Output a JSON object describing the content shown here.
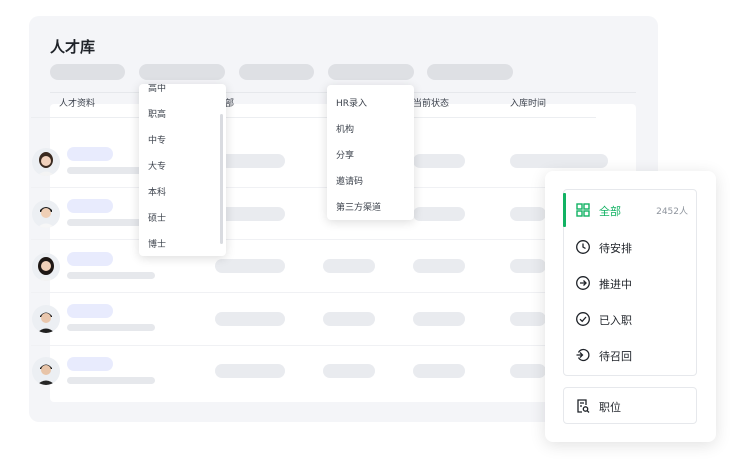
{
  "page": {
    "title": "人才库"
  },
  "table": {
    "columns": [
      "人才资料",
      "部",
      "当前状态",
      "入库时间"
    ]
  },
  "education_dropdown": {
    "options": [
      "高中",
      "职高",
      "中专",
      "大专",
      "本科",
      "硕士",
      "博士"
    ]
  },
  "source_dropdown": {
    "options": [
      "HR录入",
      "机构",
      "分享",
      "邀请码",
      "第三方渠道"
    ]
  },
  "status_panel": {
    "items": [
      {
        "label": "全部",
        "count": "2452人",
        "icon": "grid-icon",
        "active": true
      },
      {
        "label": "待安排",
        "icon": "clock-icon"
      },
      {
        "label": "推进中",
        "icon": "arrow-right-circle-icon"
      },
      {
        "label": "已入职",
        "icon": "check-circle-icon"
      },
      {
        "label": "待召回",
        "icon": "undo-icon"
      }
    ],
    "position": {
      "label": "职位",
      "icon": "document-search-icon"
    }
  },
  "colors": {
    "accent": "#12b263",
    "placeholder_blue": "#e8ebfd",
    "placeholder_gray": "#e9ebef"
  }
}
